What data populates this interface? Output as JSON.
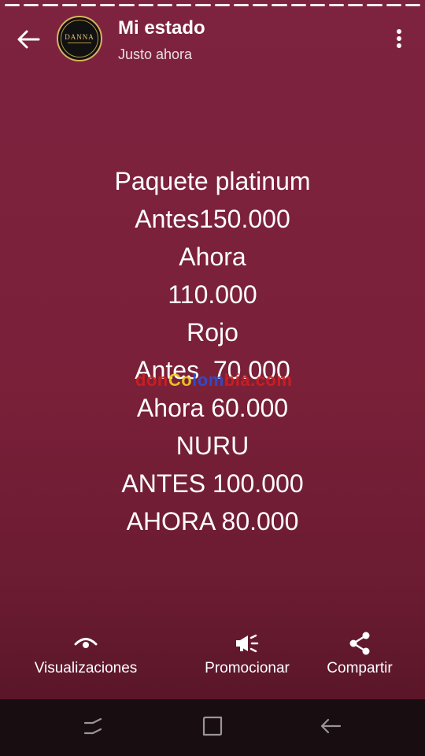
{
  "header": {
    "title": "Mi estado",
    "timestamp": "Justo ahora",
    "avatar_logo_text": "DANNA",
    "back_icon": "arrow-left-icon",
    "menu_icon": "more-vertical-icon"
  },
  "progress": {
    "segments_total": 22,
    "segments_viewed": 22
  },
  "status": {
    "lines": [
      "Paquete platinum",
      "Antes150.000",
      "Ahora",
      "110.000",
      "Rojo",
      "Antes  70.000",
      "Ahora 60.000",
      "NURU",
      "ANTES 100.000",
      "AHORA 80.000"
    ],
    "background_color": "#7a2039"
  },
  "watermark": {
    "part1": "don",
    "part2": "Co",
    "part3": "lom",
    "part4": "bia",
    "part5": ".com"
  },
  "actions": {
    "views": {
      "label": "Visualizaciones",
      "icon": "eye-icon"
    },
    "promote": {
      "label": "Promocionar",
      "icon": "megaphone-icon"
    },
    "share": {
      "label": "Compartir",
      "icon": "share-icon"
    }
  },
  "navbar": {
    "recent_icon": "recent-apps-icon",
    "home_icon": "home-icon",
    "back_icon": "nav-back-icon"
  }
}
